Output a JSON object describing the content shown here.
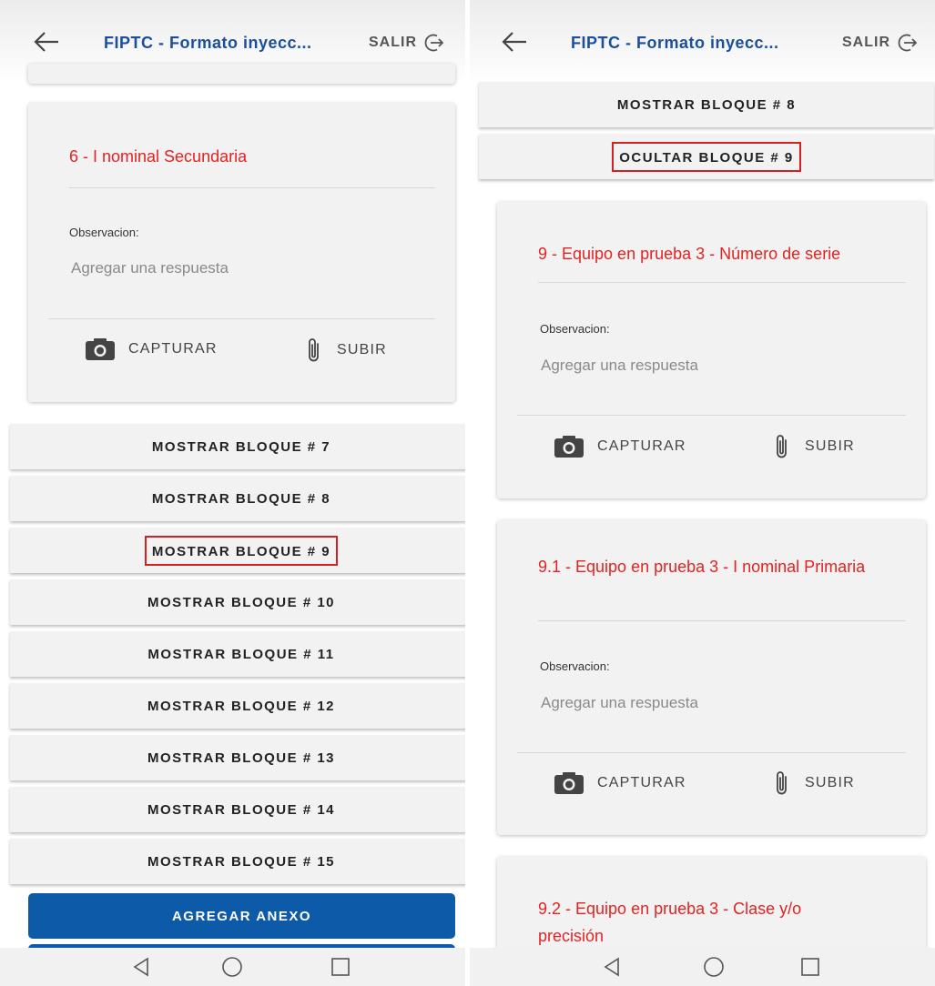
{
  "header": {
    "title": "FIPTC - Formato inyecc...",
    "exit_label": "SALIR"
  },
  "icons": {
    "back": "arrow-left-icon",
    "exit": "logout-icon",
    "camera": "camera-icon",
    "attach": "paperclip-icon",
    "nav_back": "triangle-back-icon",
    "nav_home": "circle-home-icon",
    "nav_recent": "square-recent-icon"
  },
  "colors": {
    "title": "#1b4f9c",
    "question": "#e52222",
    "primary": "#0d5ba8",
    "highlight": "#d42020"
  },
  "left": {
    "question_card": {
      "title": "6 - I nominal Secundaria",
      "observation_label": "Observacion:",
      "answer_placeholder": "Agregar una respuesta",
      "capture_label": "CAPTURAR",
      "upload_label": "SUBIR"
    },
    "blocks": [
      "MOSTRAR BLOQUE # 7",
      "MOSTRAR BLOQUE # 8",
      "MOSTRAR BLOQUE # 9",
      "MOSTRAR BLOQUE # 10",
      "MOSTRAR BLOQUE # 11",
      "MOSTRAR BLOQUE # 12",
      "MOSTRAR BLOQUE # 13",
      "MOSTRAR BLOQUE # 14",
      "MOSTRAR BLOQUE # 15"
    ],
    "add_annex_label": "AGREGAR ANEXO"
  },
  "right": {
    "blocks": [
      "MOSTRAR BLOQUE # 8",
      "OCULTAR BLOQUE # 9"
    ],
    "question_cards": [
      {
        "title": "9 - Equipo en prueba 3 - Número de serie",
        "observation_label": "Observacion:",
        "answer_placeholder": "Agregar una respuesta",
        "capture_label": "CAPTURAR",
        "upload_label": "SUBIR"
      },
      {
        "title": "9.1 - Equipo en prueba 3 - I nominal Primaria",
        "observation_label": "Observacion:",
        "answer_placeholder": "Agregar una respuesta",
        "capture_label": "CAPTURAR",
        "upload_label": "SUBIR"
      },
      {
        "title": "9.2 - Equipo en prueba 3 - Clase y/o precisión"
      }
    ]
  }
}
